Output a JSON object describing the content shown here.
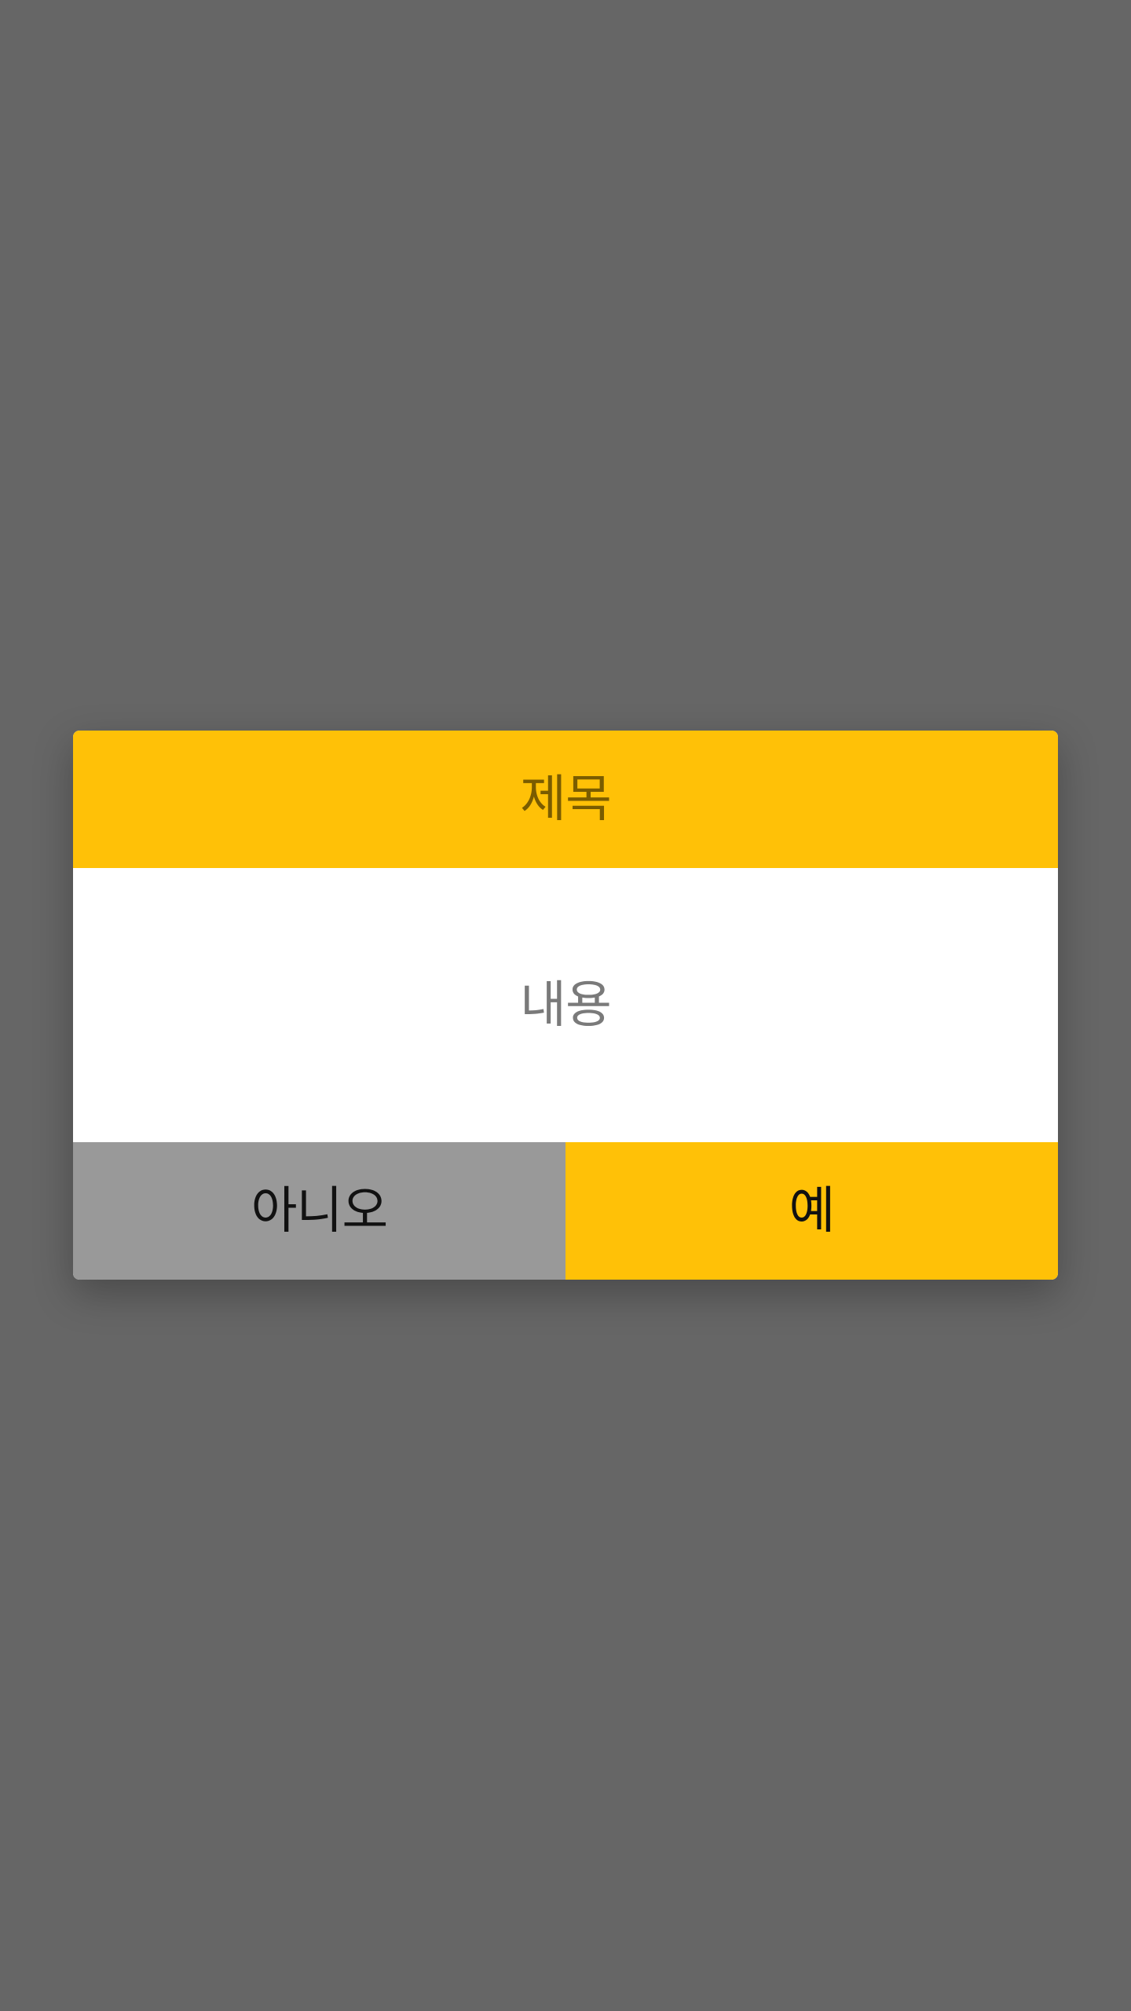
{
  "dialog": {
    "title": "제목",
    "message": "내용",
    "buttons": {
      "no": "아니오",
      "yes": "예"
    }
  },
  "colors": {
    "overlay": "#666666",
    "header": "#ffc107",
    "title_text": "#7a5c00",
    "message_text": "#7a7a7a",
    "no_button": "#999999",
    "yes_button": "#ffc107",
    "button_text": "#111111"
  }
}
